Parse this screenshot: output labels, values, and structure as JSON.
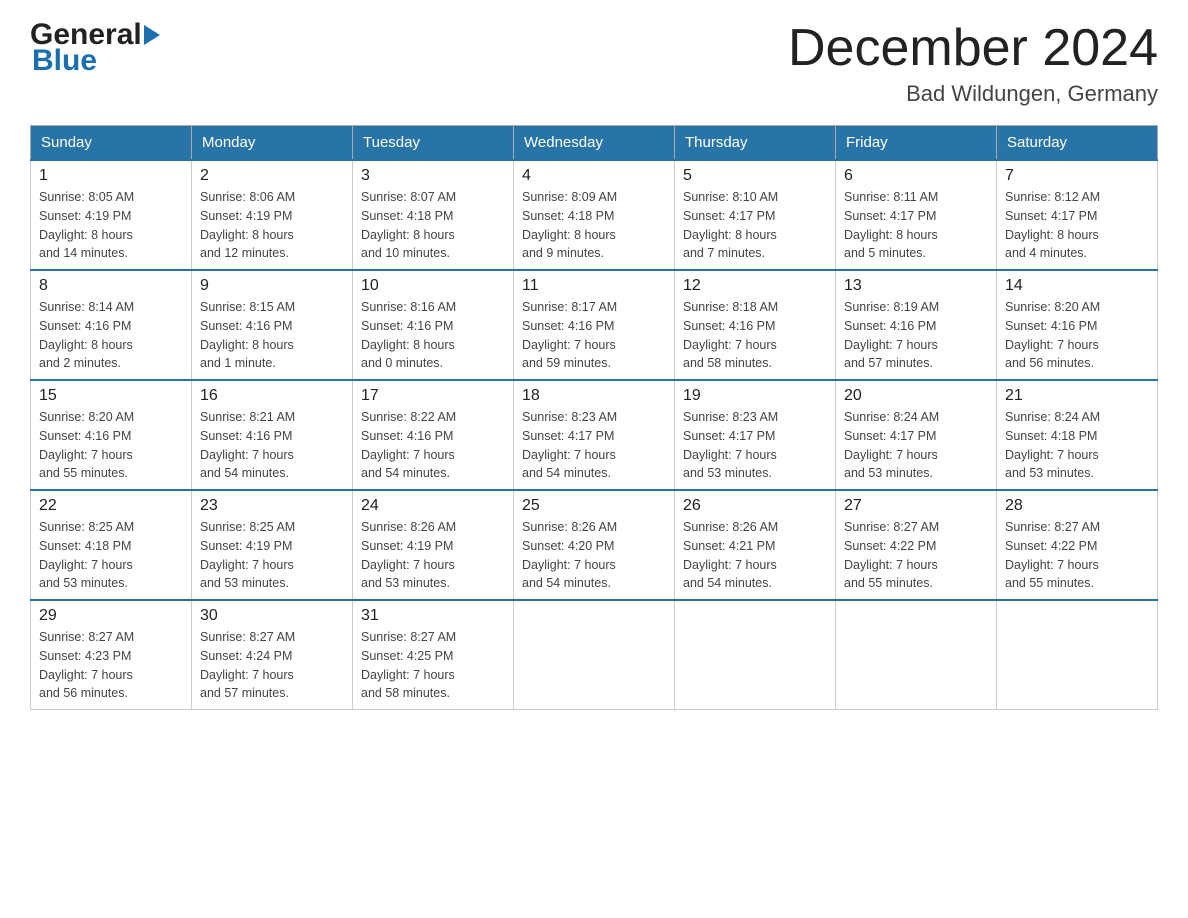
{
  "header": {
    "logo_general": "General",
    "logo_blue": "Blue",
    "month_title": "December 2024",
    "location": "Bad Wildungen, Germany"
  },
  "weekdays": [
    "Sunday",
    "Monday",
    "Tuesday",
    "Wednesday",
    "Thursday",
    "Friday",
    "Saturday"
  ],
  "weeks": [
    [
      {
        "day": "1",
        "sunrise": "8:05 AM",
        "sunset": "4:19 PM",
        "daylight": "8 hours and 14 minutes."
      },
      {
        "day": "2",
        "sunrise": "8:06 AM",
        "sunset": "4:19 PM",
        "daylight": "8 hours and 12 minutes."
      },
      {
        "day": "3",
        "sunrise": "8:07 AM",
        "sunset": "4:18 PM",
        "daylight": "8 hours and 10 minutes."
      },
      {
        "day": "4",
        "sunrise": "8:09 AM",
        "sunset": "4:18 PM",
        "daylight": "8 hours and 9 minutes."
      },
      {
        "day": "5",
        "sunrise": "8:10 AM",
        "sunset": "4:17 PM",
        "daylight": "8 hours and 7 minutes."
      },
      {
        "day": "6",
        "sunrise": "8:11 AM",
        "sunset": "4:17 PM",
        "daylight": "8 hours and 5 minutes."
      },
      {
        "day": "7",
        "sunrise": "8:12 AM",
        "sunset": "4:17 PM",
        "daylight": "8 hours and 4 minutes."
      }
    ],
    [
      {
        "day": "8",
        "sunrise": "8:14 AM",
        "sunset": "4:16 PM",
        "daylight": "8 hours and 2 minutes."
      },
      {
        "day": "9",
        "sunrise": "8:15 AM",
        "sunset": "4:16 PM",
        "daylight": "8 hours and 1 minute."
      },
      {
        "day": "10",
        "sunrise": "8:16 AM",
        "sunset": "4:16 PM",
        "daylight": "8 hours and 0 minutes."
      },
      {
        "day": "11",
        "sunrise": "8:17 AM",
        "sunset": "4:16 PM",
        "daylight": "7 hours and 59 minutes."
      },
      {
        "day": "12",
        "sunrise": "8:18 AM",
        "sunset": "4:16 PM",
        "daylight": "7 hours and 58 minutes."
      },
      {
        "day": "13",
        "sunrise": "8:19 AM",
        "sunset": "4:16 PM",
        "daylight": "7 hours and 57 minutes."
      },
      {
        "day": "14",
        "sunrise": "8:20 AM",
        "sunset": "4:16 PM",
        "daylight": "7 hours and 56 minutes."
      }
    ],
    [
      {
        "day": "15",
        "sunrise": "8:20 AM",
        "sunset": "4:16 PM",
        "daylight": "7 hours and 55 minutes."
      },
      {
        "day": "16",
        "sunrise": "8:21 AM",
        "sunset": "4:16 PM",
        "daylight": "7 hours and 54 minutes."
      },
      {
        "day": "17",
        "sunrise": "8:22 AM",
        "sunset": "4:16 PM",
        "daylight": "7 hours and 54 minutes."
      },
      {
        "day": "18",
        "sunrise": "8:23 AM",
        "sunset": "4:17 PM",
        "daylight": "7 hours and 54 minutes."
      },
      {
        "day": "19",
        "sunrise": "8:23 AM",
        "sunset": "4:17 PM",
        "daylight": "7 hours and 53 minutes."
      },
      {
        "day": "20",
        "sunrise": "8:24 AM",
        "sunset": "4:17 PM",
        "daylight": "7 hours and 53 minutes."
      },
      {
        "day": "21",
        "sunrise": "8:24 AM",
        "sunset": "4:18 PM",
        "daylight": "7 hours and 53 minutes."
      }
    ],
    [
      {
        "day": "22",
        "sunrise": "8:25 AM",
        "sunset": "4:18 PM",
        "daylight": "7 hours and 53 minutes."
      },
      {
        "day": "23",
        "sunrise": "8:25 AM",
        "sunset": "4:19 PM",
        "daylight": "7 hours and 53 minutes."
      },
      {
        "day": "24",
        "sunrise": "8:26 AM",
        "sunset": "4:19 PM",
        "daylight": "7 hours and 53 minutes."
      },
      {
        "day": "25",
        "sunrise": "8:26 AM",
        "sunset": "4:20 PM",
        "daylight": "7 hours and 54 minutes."
      },
      {
        "day": "26",
        "sunrise": "8:26 AM",
        "sunset": "4:21 PM",
        "daylight": "7 hours and 54 minutes."
      },
      {
        "day": "27",
        "sunrise": "8:27 AM",
        "sunset": "4:22 PM",
        "daylight": "7 hours and 55 minutes."
      },
      {
        "day": "28",
        "sunrise": "8:27 AM",
        "sunset": "4:22 PM",
        "daylight": "7 hours and 55 minutes."
      }
    ],
    [
      {
        "day": "29",
        "sunrise": "8:27 AM",
        "sunset": "4:23 PM",
        "daylight": "7 hours and 56 minutes."
      },
      {
        "day": "30",
        "sunrise": "8:27 AM",
        "sunset": "4:24 PM",
        "daylight": "7 hours and 57 minutes."
      },
      {
        "day": "31",
        "sunrise": "8:27 AM",
        "sunset": "4:25 PM",
        "daylight": "7 hours and 58 minutes."
      },
      null,
      null,
      null,
      null
    ]
  ],
  "labels": {
    "sunrise": "Sunrise:",
    "sunset": "Sunset:",
    "daylight": "Daylight:"
  }
}
